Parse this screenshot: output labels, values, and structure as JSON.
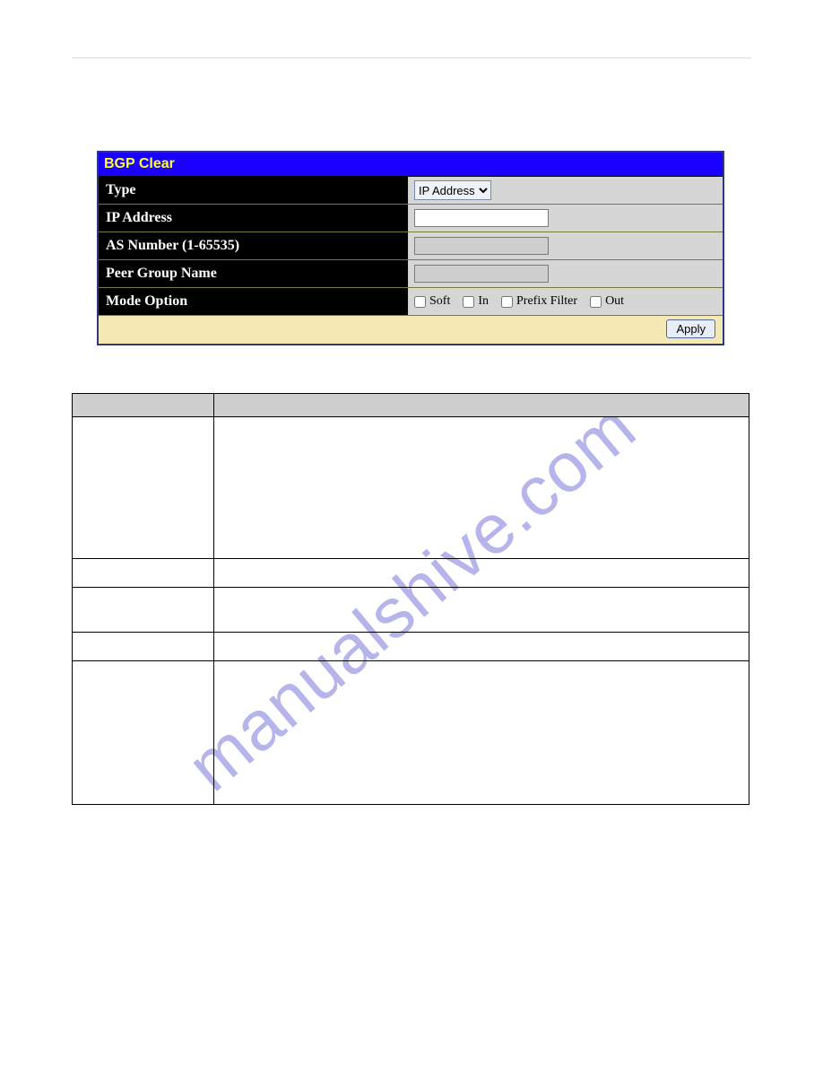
{
  "watermark": "manualshive.com",
  "panel": {
    "title": "BGP Clear",
    "rows": {
      "type_label": "Type",
      "type_options": [
        "IP Address"
      ],
      "type_selected": "IP Address",
      "ip_label": "IP Address",
      "ip_value": "",
      "as_label": "AS Number (1-65535)",
      "as_value": "",
      "peer_label": "Peer Group Name",
      "peer_value": "",
      "mode_label": "Mode Option",
      "mode_soft": "Soft",
      "mode_in": "In",
      "mode_prefix": "Prefix Filter",
      "mode_out": "Out"
    },
    "apply_label": "Apply"
  },
  "desc_table": {
    "header_param": "",
    "header_desc": "",
    "rows": [
      {
        "param": "",
        "desc": ""
      },
      {
        "param": "",
        "desc": ""
      },
      {
        "param": "",
        "desc": ""
      },
      {
        "param": "",
        "desc": ""
      },
      {
        "param": "",
        "desc": ""
      }
    ]
  }
}
